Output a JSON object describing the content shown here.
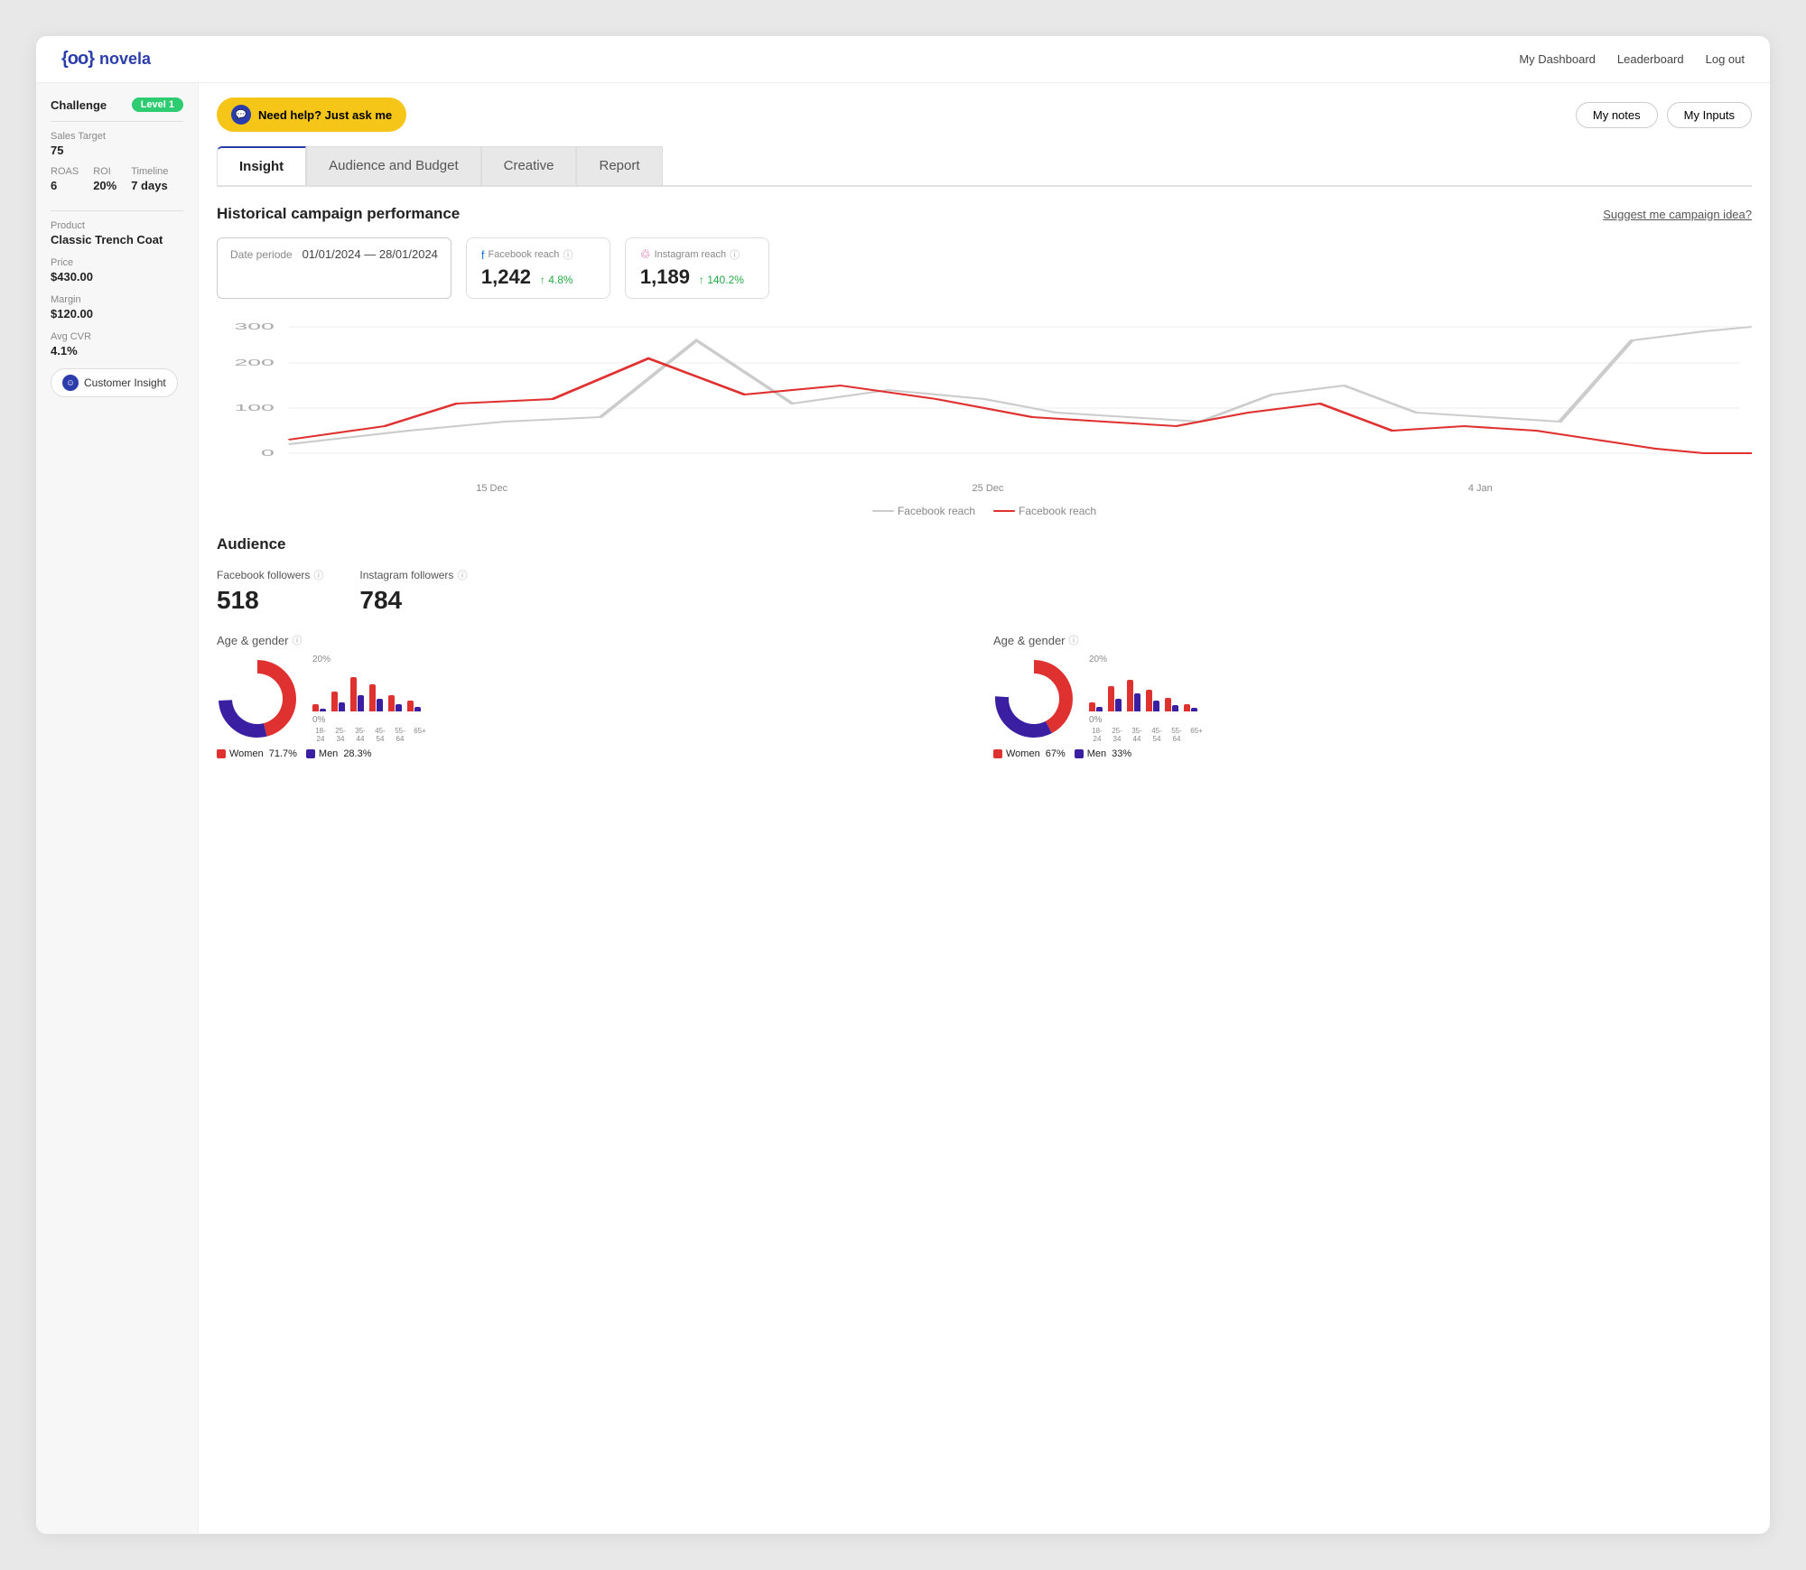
{
  "header": {
    "logo_text": "novela",
    "nav": {
      "dashboard": "My Dashboard",
      "leaderboard": "Leaderboard",
      "logout": "Log out"
    }
  },
  "top_bar": {
    "help_button": "Need help? Just ask me",
    "my_notes_button": "My notes",
    "my_inputs_button": "My Inputs"
  },
  "sidebar": {
    "challenge_label": "Challenge",
    "level_badge": "Level 1",
    "sales_target_label": "Sales Target",
    "sales_target_value": "75",
    "roas_label": "ROAS",
    "roas_value": "6",
    "roi_label": "ROI",
    "roi_value": "20%",
    "timeline_label": "Timeline",
    "timeline_value": "7 days",
    "product_label": "Product",
    "product_name": "Classic Trench Coat",
    "price_label": "Price",
    "price_value": "$430.00",
    "margin_label": "Margin",
    "margin_value": "$120.00",
    "avg_cvr_label": "Avg CVR",
    "avg_cvr_value": "4.1%",
    "customer_insight_btn": "Customer Insight"
  },
  "tabs": [
    {
      "id": "insight",
      "label": "Insight",
      "active": true
    },
    {
      "id": "audience-budget",
      "label": "Audience and Budget",
      "active": false
    },
    {
      "id": "creative",
      "label": "Creative",
      "active": false
    },
    {
      "id": "report",
      "label": "Report",
      "active": false
    }
  ],
  "historical": {
    "title": "Historical campaign performance",
    "suggest_link": "Suggest me campaign idea?",
    "date_label": "Date periode",
    "date_range": "01/01/2024 — 28/01/2024",
    "facebook_reach_label": "Facebook reach",
    "facebook_reach_value": "1,242",
    "facebook_reach_change": "↑ 4.8%",
    "instagram_reach_label": "Instagram reach",
    "instagram_reach_value": "1,189",
    "instagram_reach_change": "↑ 140.2%",
    "chart_labels": [
      "15 Dec",
      "25 Dec",
      "4 Jan"
    ],
    "legend": {
      "facebook": "Facebook reach",
      "instagram": "Facebook reach"
    }
  },
  "audience": {
    "title": "Audience",
    "facebook_followers_label": "Facebook followers",
    "facebook_followers_value": "518",
    "instagram_followers_label": "Instagram followers",
    "instagram_followers_value": "784",
    "facebook_age_gender_title": "Age & gender",
    "instagram_age_gender_title": "Age & gender",
    "facebook_donut": {
      "women_pct": 71.7,
      "men_pct": 28.3,
      "women_label": "Women",
      "men_label": "Men",
      "women_pct_text": "71.7%",
      "men_pct_text": "28.3%"
    },
    "instagram_donut": {
      "women_pct": 67,
      "men_pct": 33,
      "women_label": "Women",
      "men_label": "Men",
      "women_pct_text": "67%",
      "men_pct_text": "33%"
    },
    "bar_x_labels": [
      "18-24",
      "25-34",
      "35-44",
      "45-54",
      "55-64",
      "65+"
    ],
    "bar_y_labels": [
      "20%",
      "0%"
    ],
    "facebook_bars": [
      {
        "women": 8,
        "men": 3
      },
      {
        "women": 22,
        "men": 10
      },
      {
        "women": 38,
        "men": 18
      },
      {
        "women": 30,
        "men": 14
      },
      {
        "women": 18,
        "men": 8
      },
      {
        "women": 12,
        "men": 5
      }
    ],
    "instagram_bars": [
      {
        "women": 10,
        "men": 5
      },
      {
        "women": 28,
        "men": 14
      },
      {
        "women": 35,
        "men": 20
      },
      {
        "women": 24,
        "men": 12
      },
      {
        "women": 15,
        "men": 7
      },
      {
        "women": 8,
        "men": 4
      }
    ]
  },
  "colors": {
    "accent": "#2b3dab",
    "facebook_line": "#cccccc",
    "instagram_line": "#e03131",
    "women_color": "#e03131",
    "men_color": "#3b1fa3",
    "donut_women": "#e03131",
    "donut_men": "#3b1fa3"
  }
}
